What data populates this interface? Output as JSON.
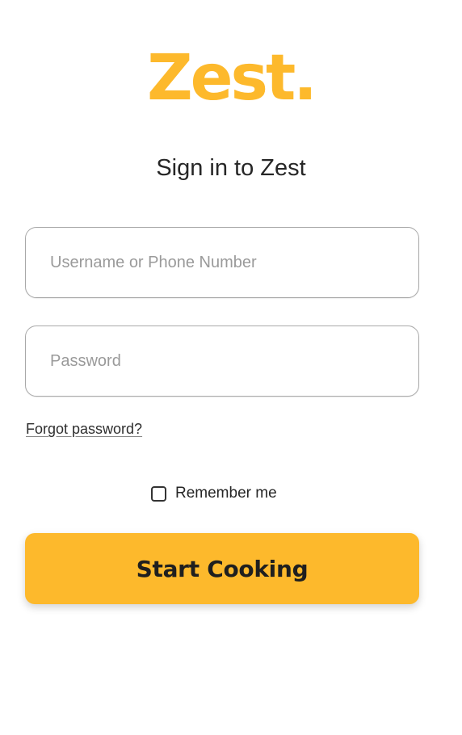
{
  "brand": {
    "name": "Zest",
    "dot": ".",
    "color": "#fdb92c"
  },
  "heading": "Sign in to Zest",
  "form": {
    "username": {
      "value": "",
      "placeholder": "Username or Phone Number"
    },
    "password": {
      "value": "",
      "placeholder": "Password"
    },
    "forgot_label": "Forgot password?",
    "remember": {
      "label": "Remember me",
      "checked": false
    },
    "submit_label": "Start Cooking"
  },
  "colors": {
    "accent": "#fdb92c",
    "border": "#a9a9a9",
    "text": "#262626",
    "placeholder": "#9a9a9a"
  }
}
